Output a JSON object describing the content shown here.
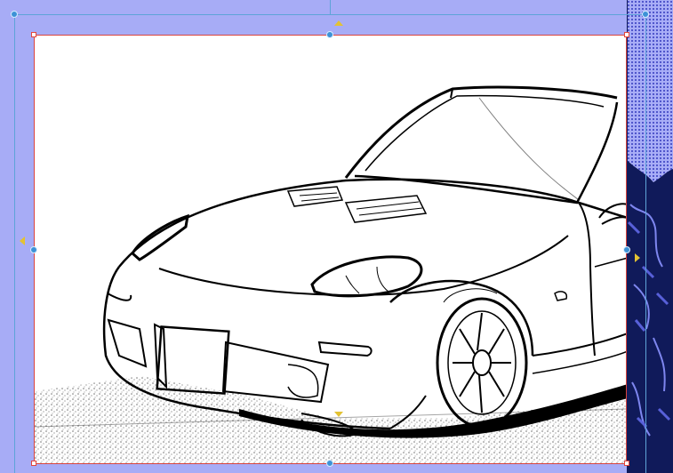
{
  "app": {
    "view": "manga-panel-editor",
    "selection": "panel-frame-selected"
  },
  "colors": {
    "workspace": "#a7acf6",
    "selection_line": "#5ea3d8",
    "handle": "#3d92d6",
    "frame_border": "#d9453f",
    "arrow": "#e3c233",
    "neighbor_panel": "#101a5a"
  },
  "icons": {
    "handles": "circle-handle-icon",
    "corners": "square-corner-handle-icon",
    "arrows": "triangle-arrow-icon"
  },
  "canvas": {
    "content": "line-art-sports-car"
  }
}
